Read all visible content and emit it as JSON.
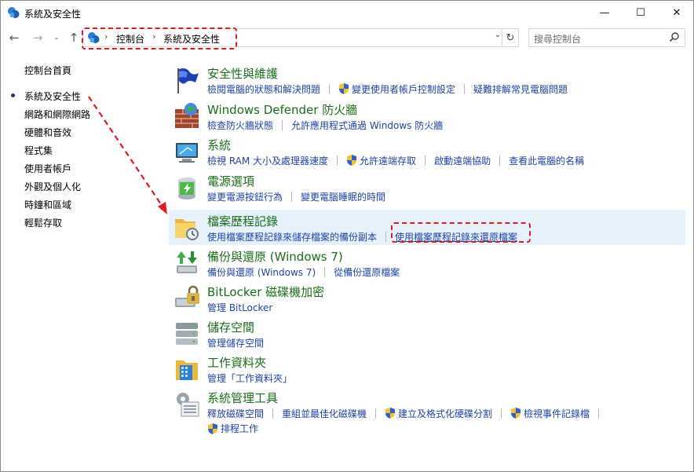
{
  "window": {
    "title": "系統及安全性",
    "minimize": "—",
    "maximize": "☐",
    "close": "✕"
  },
  "nav": {
    "back": "←",
    "forward": "→",
    "recent": "⌄",
    "up": "↑",
    "breadcrumb": [
      "控制台",
      "系統及安全性"
    ],
    "crumb_sep": "›",
    "dropdown": "⌄",
    "refresh": "↻",
    "search_placeholder": "搜尋控制台"
  },
  "sidebar": {
    "items": [
      {
        "label": "控制台首頁",
        "active": false
      },
      {
        "label": "系統及安全性",
        "active": true
      },
      {
        "label": "網路和網際網路",
        "active": false
      },
      {
        "label": "硬體和音效",
        "active": false
      },
      {
        "label": "程式集",
        "active": false
      },
      {
        "label": "使用者帳戶",
        "active": false
      },
      {
        "label": "外觀及個人化",
        "active": false
      },
      {
        "label": "時鐘和區域",
        "active": false
      },
      {
        "label": "輕鬆存取",
        "active": false
      }
    ]
  },
  "categories": [
    {
      "icon": "flag-icon",
      "title": "安全性與維護",
      "links": [
        {
          "text": "檢閱電腦的狀態和解決問題",
          "shield": false
        },
        {
          "text": "變更使用者帳戶控制設定",
          "shield": true
        },
        {
          "text": "疑難排解常見電腦問題",
          "shield": false
        }
      ]
    },
    {
      "icon": "firewall-icon",
      "title": "Windows Defender 防火牆",
      "links": [
        {
          "text": "檢查防火牆狀態",
          "shield": false
        },
        {
          "text": "允許應用程式通過 Windows 防火牆",
          "shield": false
        }
      ]
    },
    {
      "icon": "system-icon",
      "title": "系統",
      "links": [
        {
          "text": "檢視 RAM 大小及處理器速度",
          "shield": false
        },
        {
          "text": "允許遠端存取",
          "shield": true
        },
        {
          "text": "啟動遠端協助",
          "shield": false
        },
        {
          "text": "查看此電腦的名稱",
          "shield": false
        }
      ]
    },
    {
      "icon": "power-icon",
      "title": "電源選項",
      "links": [
        {
          "text": "變更電源按鈕行為",
          "shield": false
        },
        {
          "text": "變更電腦睡眠的時間",
          "shield": false
        }
      ]
    },
    {
      "icon": "file-history-icon",
      "title": "檔案歷程記錄",
      "selected": true,
      "links": [
        {
          "text": "使用檔案歷程記錄來儲存檔案的備份副本",
          "shield": false
        },
        {
          "text": "使用檔案歷程記錄來還原檔案",
          "shield": false,
          "highlighted": true
        }
      ]
    },
    {
      "icon": "backup-icon",
      "title": "備份與還原 (Windows 7)",
      "links": [
        {
          "text": "備份與還原 (Windows 7)",
          "shield": false
        },
        {
          "text": "從備份還原檔案",
          "shield": false
        }
      ]
    },
    {
      "icon": "bitlocker-icon",
      "title": "BitLocker 磁碟機加密",
      "links": [
        {
          "text": "管理 BitLocker",
          "shield": false
        }
      ]
    },
    {
      "icon": "storage-spaces-icon",
      "title": "儲存空間",
      "links": [
        {
          "text": "管理儲存空間",
          "shield": false
        }
      ]
    },
    {
      "icon": "work-folders-icon",
      "title": "工作資料夾",
      "links": [
        {
          "text": "管理「工作資料夾」",
          "shield": false
        }
      ]
    },
    {
      "icon": "admin-tools-icon",
      "title": "系統管理工具",
      "links": [
        {
          "text": "釋放磁碟空間",
          "shield": false
        },
        {
          "text": "重組並最佳化磁碟機",
          "shield": false
        },
        {
          "text": "建立及格式化硬碟分割",
          "shield": true
        },
        {
          "text": "檢視事件記錄檔",
          "shield": true
        }
      ],
      "links2": [
        {
          "text": "排程工作",
          "shield": true
        }
      ]
    }
  ],
  "colors": {
    "category_title": "#1a6e1a",
    "link": "#1f43a7",
    "annotation": "#e01b1b",
    "selected_bg": "#e5f1fb"
  }
}
